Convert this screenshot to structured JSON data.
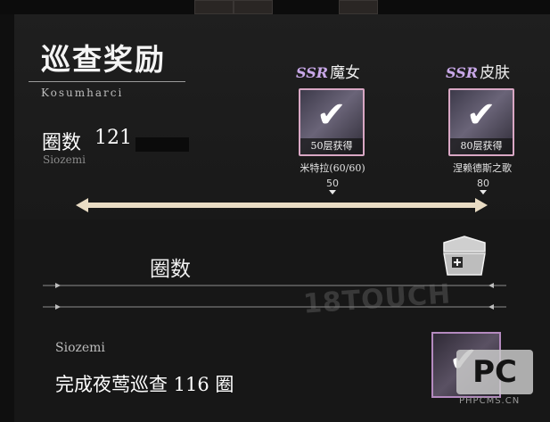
{
  "header": {
    "title": "巡查奖励",
    "subtitle": "Kosumharci"
  },
  "laps": {
    "label": "圈数",
    "value": "121",
    "sub": "Siozemi"
  },
  "rewards": [
    {
      "rarity": "SSR",
      "type": "魔女",
      "caption": "50层获得",
      "name": "米特拉(60/60)",
      "threshold": "50",
      "claimed": true
    },
    {
      "rarity": "SSR",
      "type": "皮肤",
      "caption": "80层获得",
      "name": "涅赖德斯之歌",
      "threshold": "80",
      "claimed": true
    }
  ],
  "section": {
    "heading": "圈数"
  },
  "task": {
    "sub": "Siozemi",
    "text": "完成夜莺巡查 116 圈",
    "claimed": true
  },
  "watermark": {
    "text": "18TOUCH",
    "logo": "PC",
    "url": "PHPCMS.CN"
  },
  "icons": {
    "check": "check-icon",
    "chest": "treasure-chest-icon",
    "arrow": "double-arrow-icon"
  },
  "colors": {
    "background": "#141414",
    "ssr_purple": "#c9a8e8",
    "card_border": "#d9a7c4",
    "track": "#e9dcc4"
  }
}
